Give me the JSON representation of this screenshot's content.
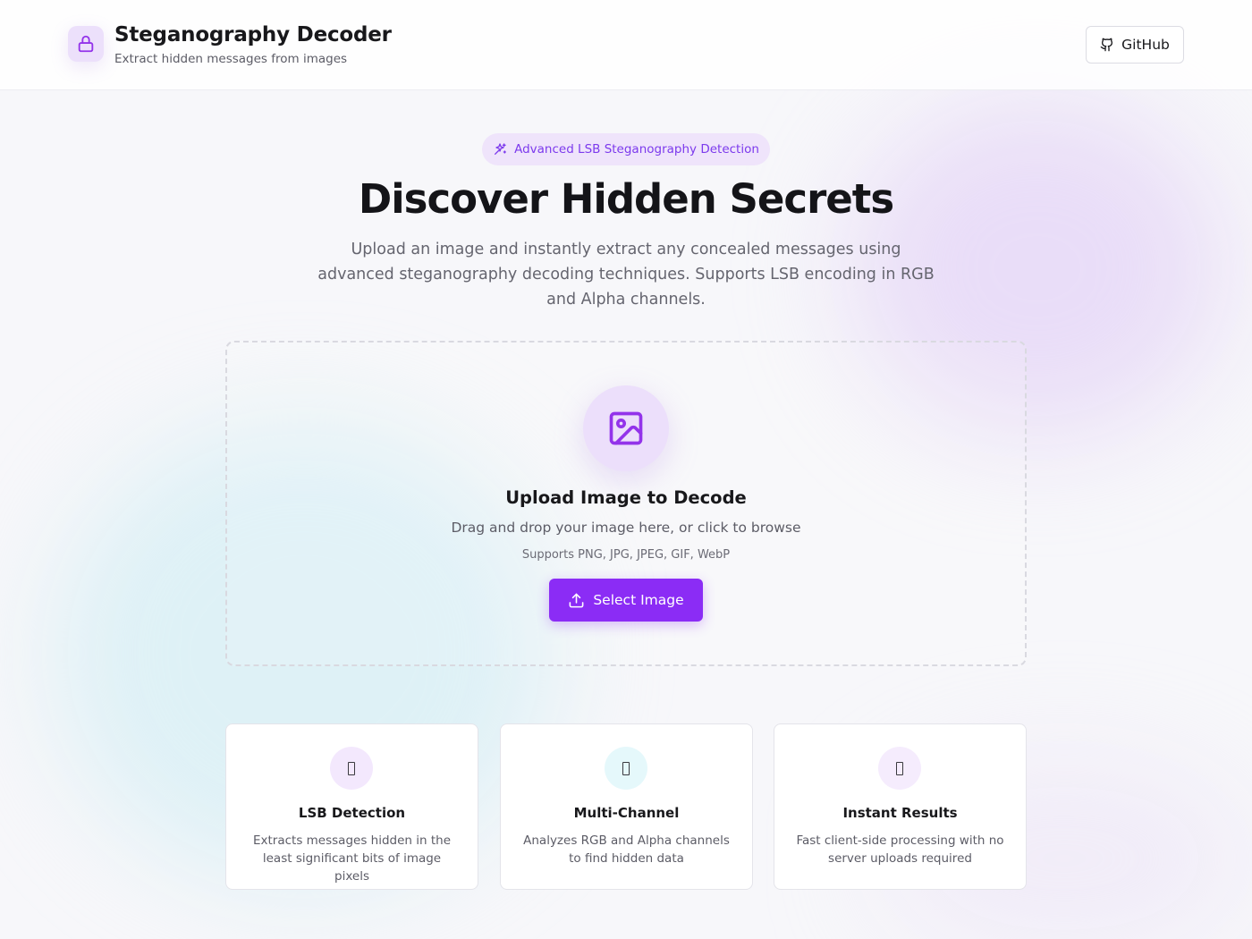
{
  "header": {
    "title": "Steganography Decoder",
    "subtitle": "Extract hidden messages from images",
    "logo_icon": "lock-icon",
    "github_label": "GitHub",
    "github_icon": "github-icon"
  },
  "hero": {
    "badge_label": "Advanced LSB Steganography Detection",
    "badge_icon": "sparkles-icon",
    "title": "Discover Hidden Secrets",
    "description": "Upload an image and instantly extract any concealed messages using advanced steganography decoding techniques. Supports LSB encoding in RGB and Alpha channels."
  },
  "upload": {
    "icon": "image-icon",
    "title": "Upload Image to Decode",
    "description": "Drag and drop your image here, or click to browse",
    "formats": "Supports PNG, JPG, JPEG, GIF, WebP",
    "button_label": "Select Image",
    "button_icon": "upload-icon"
  },
  "features": [
    {
      "title": "LSB Detection",
      "description": "Extracts messages hidden in the least significant bits of image pixels",
      "icon_bg": "#f3e8fd"
    },
    {
      "title": "Multi-Channel",
      "description": "Analyzes RGB and Alpha channels to find hidden data",
      "icon_bg": "#e5f8fb"
    },
    {
      "title": "Instant Results",
      "description": "Fast client-side processing with no server uploads required",
      "icon_bg": "#f5ecfd"
    }
  ],
  "colors": {
    "accent": "#8b2cf5",
    "accent_text": "#7c3aed",
    "badge_bg": "#efe4fb",
    "logo_bg": "#ece0fb"
  }
}
